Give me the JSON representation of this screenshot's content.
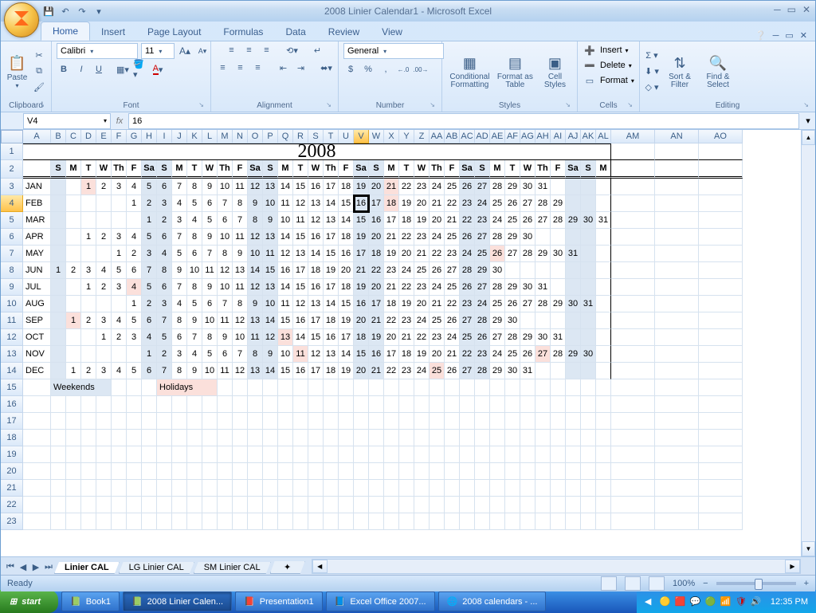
{
  "title": "2008 Linier Calendar1 - Microsoft Excel",
  "qat": {
    "save": "💾",
    "undo": "↶",
    "redo": "↷"
  },
  "tabs": [
    "Home",
    "Insert",
    "Page Layout",
    "Formulas",
    "Data",
    "Review",
    "View"
  ],
  "active_tab": 0,
  "ribbon": {
    "clipboard": {
      "label": "Clipboard",
      "paste": "Paste"
    },
    "font": {
      "label": "Font",
      "name": "Calibri",
      "size": "11",
      "bold": "B",
      "italic": "I",
      "underline": "U"
    },
    "alignment": {
      "label": "Alignment"
    },
    "number": {
      "label": "Number",
      "format": "General",
      "currency": "$",
      "percent": "%",
      "comma": ",",
      "inc": "←.0",
      "dec": ".00→"
    },
    "styles": {
      "label": "Styles",
      "cf": "Conditional Formatting",
      "ft": "Format as Table",
      "cs": "Cell Styles"
    },
    "cells": {
      "label": "Cells",
      "insert": "Insert",
      "delete": "Delete",
      "format": "Format"
    },
    "editing": {
      "label": "Editing",
      "sort": "Sort & Filter",
      "find": "Find & Select"
    }
  },
  "namebox": "V4",
  "formula": "16",
  "columns": [
    {
      "l": "A",
      "w": 35
    },
    {
      "l": "B",
      "w": 19
    },
    {
      "l": "C",
      "w": 19
    },
    {
      "l": "D",
      "w": 19
    },
    {
      "l": "E",
      "w": 19
    },
    {
      "l": "F",
      "w": 19
    },
    {
      "l": "G",
      "w": 19
    },
    {
      "l": "H",
      "w": 19
    },
    {
      "l": "I",
      "w": 19
    },
    {
      "l": "J",
      "w": 19
    },
    {
      "l": "K",
      "w": 19
    },
    {
      "l": "L",
      "w": 19
    },
    {
      "l": "M",
      "w": 19
    },
    {
      "l": "N",
      "w": 19
    },
    {
      "l": "O",
      "w": 19
    },
    {
      "l": "P",
      "w": 19
    },
    {
      "l": "Q",
      "w": 19
    },
    {
      "l": "R",
      "w": 19
    },
    {
      "l": "S",
      "w": 19
    },
    {
      "l": "T",
      "w": 19
    },
    {
      "l": "U",
      "w": 19
    },
    {
      "l": "V",
      "w": 19
    },
    {
      "l": "W",
      "w": 19
    },
    {
      "l": "X",
      "w": 19
    },
    {
      "l": "Y",
      "w": 19
    },
    {
      "l": "Z",
      "w": 19
    },
    {
      "l": "AA",
      "w": 19
    },
    {
      "l": "AB",
      "w": 19
    },
    {
      "l": "AC",
      "w": 19
    },
    {
      "l": "AD",
      "w": 19
    },
    {
      "l": "AE",
      "w": 19
    },
    {
      "l": "AF",
      "w": 19
    },
    {
      "l": "AG",
      "w": 19
    },
    {
      "l": "AH",
      "w": 19
    },
    {
      "l": "AI",
      "w": 19
    },
    {
      "l": "AJ",
      "w": 19
    },
    {
      "l": "AK",
      "w": 19
    },
    {
      "l": "AL",
      "w": 19
    },
    {
      "l": "AM",
      "w": 55
    },
    {
      "l": "AN",
      "w": 55
    },
    {
      "l": "AO",
      "w": 55
    }
  ],
  "row_numbers": [
    1,
    2,
    3,
    4,
    5,
    6,
    7,
    8,
    9,
    10,
    11,
    12,
    13,
    14,
    15,
    16,
    17,
    18,
    19,
    20,
    21,
    22,
    23
  ],
  "year": "2008",
  "day_headers": [
    "S",
    "M",
    "T",
    "W",
    "Th",
    "F",
    "Sa",
    "S",
    "M",
    "T",
    "W",
    "Th",
    "F",
    "Sa",
    "S",
    "M",
    "T",
    "W",
    "Th",
    "F",
    "Sa",
    "S",
    "M",
    "T",
    "W",
    "Th",
    "F",
    "Sa",
    "S",
    "M",
    "T",
    "W",
    "Th",
    "F",
    "Sa",
    "S",
    "M"
  ],
  "months": [
    {
      "name": "JAN",
      "offset": 2,
      "days": 31,
      "holidays": [
        1,
        21
      ]
    },
    {
      "name": "FEB",
      "offset": 5,
      "days": 29,
      "holidays": [
        18
      ]
    },
    {
      "name": "MAR",
      "offset": 6,
      "days": 31,
      "holidays": []
    },
    {
      "name": "APR",
      "offset": 2,
      "days": 30,
      "holidays": []
    },
    {
      "name": "MAY",
      "offset": 4,
      "days": 31,
      "holidays": [
        26
      ]
    },
    {
      "name": "JUN",
      "offset": 0,
      "days": 30,
      "holidays": []
    },
    {
      "name": "JUL",
      "offset": 2,
      "days": 31,
      "holidays": [
        4
      ]
    },
    {
      "name": "AUG",
      "offset": 5,
      "days": 31,
      "holidays": []
    },
    {
      "name": "SEP",
      "offset": 1,
      "days": 30,
      "holidays": [
        1
      ]
    },
    {
      "name": "OCT",
      "offset": 3,
      "days": 31,
      "holidays": [
        13
      ]
    },
    {
      "name": "NOV",
      "offset": 6,
      "days": 30,
      "holidays": [
        11,
        27
      ]
    },
    {
      "name": "DEC",
      "offset": 1,
      "days": 31,
      "holidays": [
        25
      ]
    }
  ],
  "legend": {
    "weekends": "Weekends",
    "holidays": "Holidays"
  },
  "selected_cell": {
    "row": 4,
    "col_idx": 21
  },
  "sheets": [
    "Linier CAL",
    "LG Linier CAL",
    "SM Linier CAL"
  ],
  "active_sheet": 0,
  "status": "Ready",
  "zoom": "100%",
  "taskbar": {
    "start": "start",
    "items": [
      {
        "label": "Book1",
        "icon": "📗"
      },
      {
        "label": "2008 Linier Calen...",
        "icon": "📗",
        "active": true
      },
      {
        "label": "Presentation1",
        "icon": "📕"
      },
      {
        "label": "Excel Office 2007...",
        "icon": "📘"
      },
      {
        "label": "2008 calendars - ...",
        "icon": "🌐"
      }
    ],
    "clock": "12:35 PM"
  }
}
